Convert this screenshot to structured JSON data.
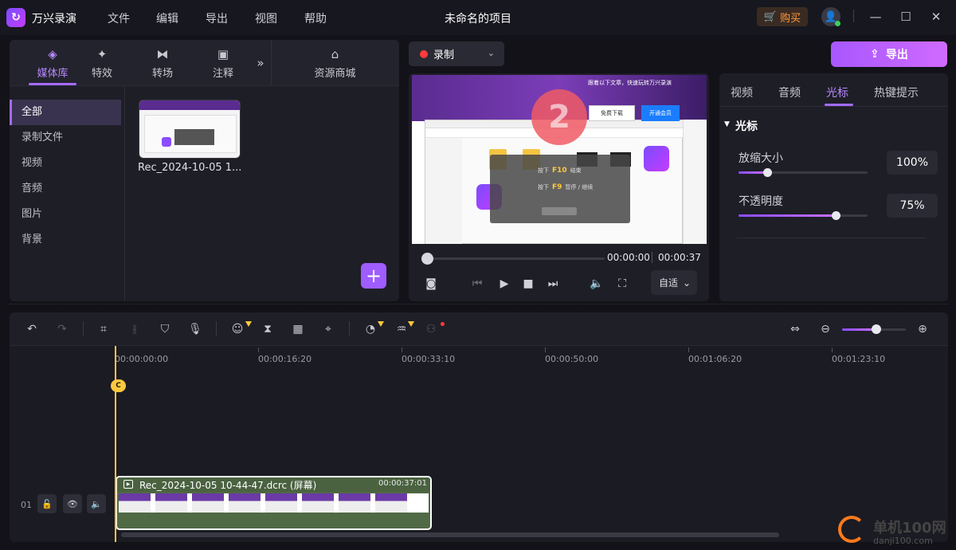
{
  "app": {
    "name": "万兴录演",
    "project_title": "未命名的项目",
    "menu": [
      "文件",
      "编辑",
      "导出",
      "视图",
      "帮助"
    ],
    "buy_label": "购买"
  },
  "media_panel": {
    "tabs": [
      {
        "label": "媒体库",
        "icon": "layers-icon",
        "active": true
      },
      {
        "label": "特效",
        "icon": "sparkle-icon",
        "active": false
      },
      {
        "label": "转场",
        "icon": "transition-icon",
        "active": false
      },
      {
        "label": "注释",
        "icon": "annotation-icon",
        "active": false
      },
      {
        "label": "资源商城",
        "icon": "store-icon",
        "active": false
      }
    ],
    "categories": [
      "全部",
      "录制文件",
      "视频",
      "音频",
      "图片",
      "背景"
    ],
    "active_category": "全部",
    "media_item_label": "Rec_2024-10-05 1..."
  },
  "recorder": {
    "label": "录制"
  },
  "preview": {
    "screen_caption": "跟着以下文章，快速玩转万兴录演",
    "countdown": "2",
    "btn_download": "免费下载",
    "btn_member": "开通会员",
    "hotkey_lines": [
      {
        "prefix": "按下",
        "key": "F10",
        "action": "结束"
      },
      {
        "prefix": "按下",
        "key": "F9",
        "action": "暂停 / 继续"
      }
    ],
    "time_current": "00:00:00",
    "time_total": "00:00:37",
    "progress": 0.0,
    "fit_label": "自适"
  },
  "export": {
    "label": "导出"
  },
  "properties": {
    "tabs": [
      "视频",
      "音频",
      "光标",
      "热键提示"
    ],
    "active_tab": "光标",
    "section_title": "光标",
    "scale_label": "放缩大小",
    "scale_value": "100%",
    "scale_level": 0.22,
    "opacity_label": "不透明度",
    "opacity_value": "75%",
    "opacity_level": 0.75
  },
  "timeline": {
    "ruler_marks": [
      "00:00:00:00",
      "00:00:16:20",
      "00:00:33:10",
      "00:00:50:00",
      "00:01:06:20",
      "00:01:23:10"
    ],
    "track_number": "01",
    "clip_title": "Rec_2024-10-05 10-44-47.dcrc (屏幕)",
    "clip_duration": "00:00:37:01",
    "playhead_tag": "C",
    "zoom_level": 0.54
  },
  "watermark": {
    "name": "单机100网",
    "url": "danji100.com"
  },
  "colors": {
    "accent": "#a36bff",
    "record": "#ff3b3b",
    "playhead": "#ffc83d",
    "buy": "#ff9a3c"
  }
}
